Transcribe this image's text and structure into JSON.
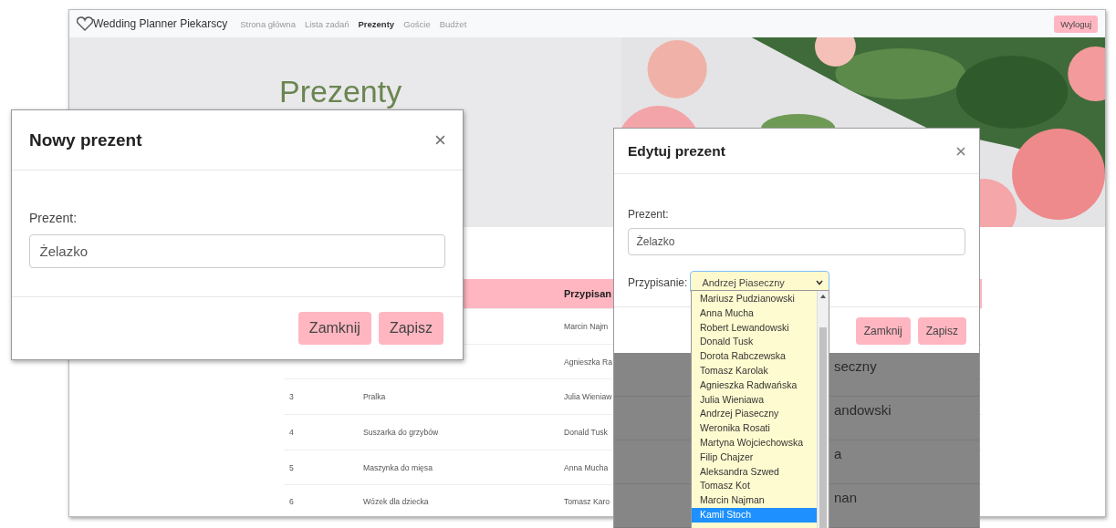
{
  "page": {
    "brand": "Wedding Planner Piekarscy",
    "nav": [
      {
        "label": "Strona główna",
        "selected": false
      },
      {
        "label": "Lista zadań",
        "selected": false
      },
      {
        "label": "Prezenty",
        "selected": true
      },
      {
        "label": "Goście",
        "selected": false
      },
      {
        "label": "Budżet",
        "selected": false
      }
    ],
    "logout": "Wyloguj",
    "hero_title": "Prezenty",
    "table": {
      "columns": [
        null,
        null,
        "Przypisan"
      ],
      "rows": [
        {
          "assigned": "Marcin Najm"
        },
        {
          "assigned": "Agnieszka Ra"
        },
        {
          "number": "3",
          "gift": "Pralka",
          "assigned": "Julia Wieniaw"
        },
        {
          "number": "4",
          "gift": "Suszarka do grzybów",
          "assigned": "Donald Tusk"
        },
        {
          "number": "5",
          "gift": "Maszynka do mięsa",
          "assigned": "Anna Mucha"
        },
        {
          "number": "6",
          "gift": "Wózek dla dziecka",
          "assigned": "Tomasz Karo"
        }
      ]
    }
  },
  "new_dialog": {
    "title": "Nowy prezent",
    "field_label": "Prezent:",
    "value": "Żelazko",
    "buttons": [
      "Zamknij",
      "Zapisz"
    ]
  },
  "edit_dialog": {
    "title": "Edytuj prezent",
    "field_label": "Prezent:",
    "value": "Żelazko",
    "assign_label": "Przypisanie:",
    "assign_value": "Andrzej Piaseczny",
    "buttons": [
      "Zamknij",
      "Zapisz"
    ],
    "options": [
      {
        "label": "Mariusz Pudzianowski",
        "selected": false
      },
      {
        "label": "Anna Mucha",
        "selected": false
      },
      {
        "label": "Robert Lewandowski",
        "selected": false
      },
      {
        "label": "Donald Tusk",
        "selected": false
      },
      {
        "label": "Dorota Rabczewska",
        "selected": false
      },
      {
        "label": "Tomasz Karolak",
        "selected": false
      },
      {
        "label": "Agnieszka Radwańska",
        "selected": false
      },
      {
        "label": "Julia Wieniawa",
        "selected": false
      },
      {
        "label": "Andrzej Piaseczny",
        "selected": false
      },
      {
        "label": "Weronika Rosati",
        "selected": false
      },
      {
        "label": "Martyna Wojciechowska",
        "selected": false
      },
      {
        "label": "Filip Chajzer",
        "selected": false
      },
      {
        "label": "Aleksandra Szwed",
        "selected": false
      },
      {
        "label": "Tomasz Kot",
        "selected": false
      },
      {
        "label": "Marcin Najman",
        "selected": false
      },
      {
        "label": "Kamil Stoch",
        "selected": true
      }
    ],
    "backdrop_rows": [
      "seczny",
      "andowski",
      "a",
      "nan"
    ]
  }
}
